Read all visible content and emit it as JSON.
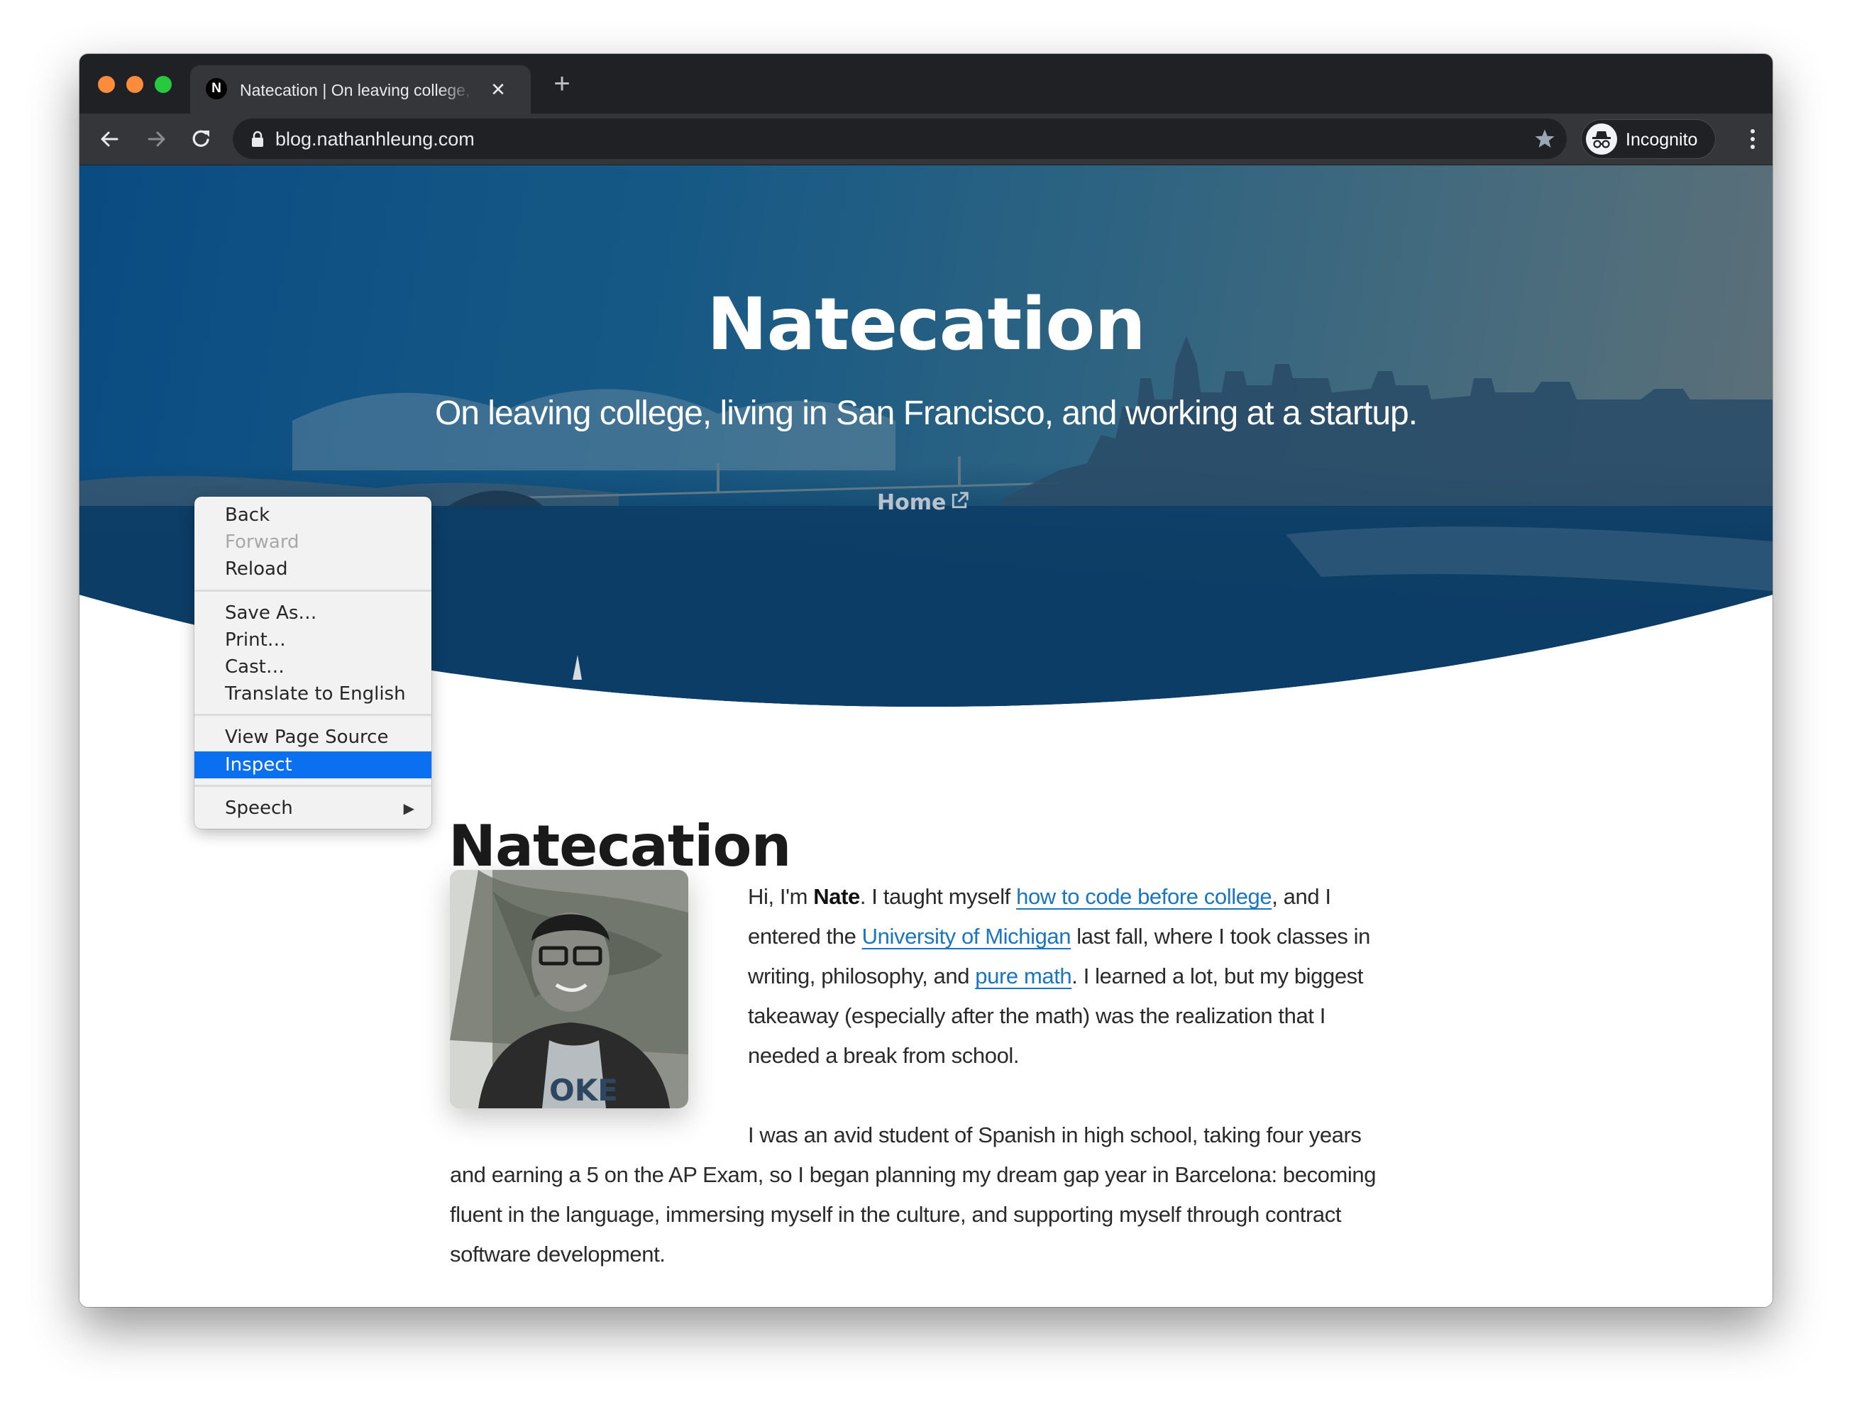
{
  "browser": {
    "tab": {
      "favicon_letter": "N",
      "title": "Natecation | On leaving college, living in San Francisco, and working at a startup.",
      "close_label": "✕"
    },
    "new_tab_label": "+",
    "url": "blog.nathanhleung.com",
    "profile_label": "Incognito",
    "traffic_light_colors": {
      "close": "#fb8c3c",
      "minimize": "#fb8c3c",
      "maximize": "#27c93f"
    }
  },
  "hero": {
    "title": "Natecation",
    "subtitle": "On leaving college, living in San Francisco, and working at a startup.",
    "home_link": "Home"
  },
  "content": {
    "title": "Natecation",
    "para1": {
      "t1": "Hi, I'm ",
      "bold": "Nate",
      "t2": ". I taught myself ",
      "link1": "how to code before college",
      "t3": ", and I entered the ",
      "link2": "University of Michigan",
      "t4": " last fall, where I took classes in writing, philosophy, and ",
      "link3": "pure math",
      "t5": ". I learned a lot, but my biggest takeaway (especially after the math) was the realization that I needed a break from school."
    },
    "para2": "I was an avid student of Spanish in high school, taking four years and earning a 5 on the AP Exam, so I began planning my dream gap year in Barcelona: becoming fluent in the language, immersing myself in the culture, and supporting myself through contract software development.",
    "link_color": "#1a75c4"
  },
  "context_menu": {
    "items": [
      {
        "label": "Back",
        "disabled": false
      },
      {
        "label": "Forward",
        "disabled": true
      },
      {
        "label": "Reload",
        "disabled": false
      },
      {
        "label": "Save As…",
        "disabled": false
      },
      {
        "label": "Print…",
        "disabled": false
      },
      {
        "label": "Cast…",
        "disabled": false
      },
      {
        "label": "Translate to English",
        "disabled": false
      },
      {
        "label": "View Page Source",
        "disabled": false
      },
      {
        "label": "Inspect",
        "disabled": false,
        "selected": true
      },
      {
        "label": "Speech",
        "disabled": false,
        "submenu": true
      }
    ],
    "submenu_arrow": "▶",
    "highlight_color": "#0b70f0"
  }
}
